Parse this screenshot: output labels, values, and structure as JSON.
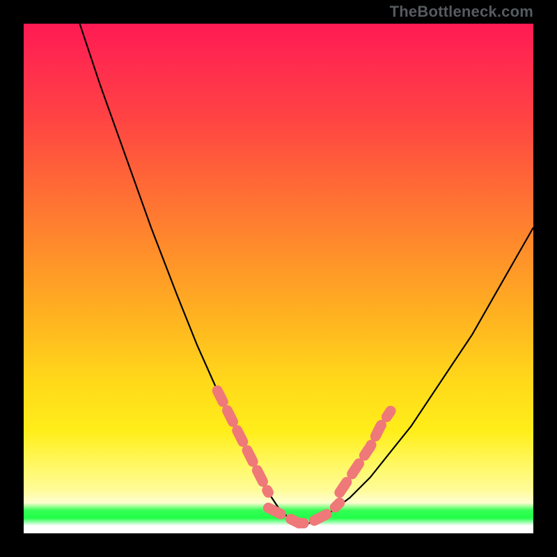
{
  "attribution": "TheBottleneck.com",
  "chart_data": {
    "type": "line",
    "title": "",
    "xlabel": "",
    "ylabel": "",
    "xlim": [
      0,
      100
    ],
    "ylim": [
      0,
      100
    ],
    "series": [
      {
        "name": "black-curve",
        "x": [
          11,
          15,
          20,
          25,
          30,
          34,
          38,
          42,
          46,
          48,
          50,
          52,
          54,
          56,
          60,
          64,
          68,
          72,
          76,
          80,
          84,
          88,
          92,
          96,
          100
        ],
        "values": [
          100,
          88,
          74,
          60,
          47,
          37,
          28,
          20,
          12,
          8,
          5,
          3,
          2,
          2,
          4,
          7,
          11,
          16,
          21,
          27,
          33,
          39,
          46,
          53,
          60
        ]
      },
      {
        "name": "salmon-dash-left",
        "x": [
          38,
          40,
          42,
          44,
          46,
          48
        ],
        "values": [
          28,
          24,
          20,
          16,
          12,
          8
        ]
      },
      {
        "name": "salmon-dash-bottom",
        "x": [
          48,
          50,
          52,
          54,
          56,
          58,
          60,
          62
        ],
        "values": [
          5,
          4,
          3,
          2,
          2,
          3,
          4,
          6
        ]
      },
      {
        "name": "salmon-dash-right",
        "x": [
          62,
          64,
          66,
          68,
          70,
          72
        ],
        "values": [
          8,
          11,
          14,
          17,
          21,
          24
        ]
      }
    ]
  },
  "colors": {
    "black_curve": "#000000",
    "salmon": "#ef7879",
    "gradient_top": "#ff1a52",
    "gradient_green": "#20ff48"
  }
}
